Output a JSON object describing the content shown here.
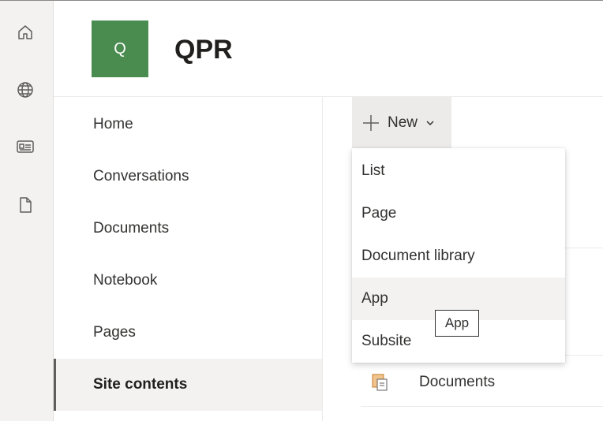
{
  "app_bar": {
    "icons": [
      "home-icon",
      "globe-icon",
      "news-icon",
      "document-icon"
    ]
  },
  "site": {
    "logo_letter": "Q",
    "title": "QPR",
    "logo_color": "#4a8c4f"
  },
  "nav": {
    "items": [
      {
        "label": "Home"
      },
      {
        "label": "Conversations"
      },
      {
        "label": "Documents"
      },
      {
        "label": "Notebook"
      },
      {
        "label": "Pages"
      },
      {
        "label": "Site contents",
        "selected": true
      }
    ]
  },
  "toolbar": {
    "new_label": "New"
  },
  "new_menu": {
    "items": [
      {
        "label": "List"
      },
      {
        "label": "Page"
      },
      {
        "label": "Document library"
      },
      {
        "label": "App",
        "hovered": true
      },
      {
        "label": "Subsite"
      }
    ]
  },
  "tooltip": {
    "text": "App"
  },
  "contents": {
    "rows": [
      {
        "label": "Documents",
        "icon": "document-library-icon"
      }
    ]
  }
}
